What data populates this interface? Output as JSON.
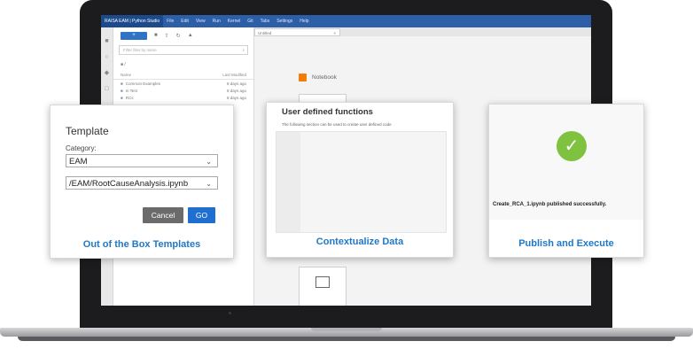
{
  "app": {
    "title": "RAISA EAM | Python Studio",
    "menu": [
      "File",
      "Edit",
      "View",
      "Run",
      "Kernel",
      "Git",
      "Tabs",
      "Settings",
      "Help"
    ]
  },
  "file_browser": {
    "new_button": "+",
    "search_placeholder": "Filter files by name",
    "breadcrumb": "■ /",
    "columns": {
      "name": "Name",
      "modified": "Last Modified"
    },
    "rows": [
      {
        "name": "Common Examples",
        "modified": "8 days ago"
      },
      {
        "name": "In Test",
        "modified": "8 days ago"
      },
      {
        "name": "RCs",
        "modified": "8 days ago"
      }
    ]
  },
  "tabs": [
    {
      "label": "Untitled",
      "close": "×"
    }
  ],
  "launcher": {
    "section": "Notebook"
  },
  "template_card": {
    "title": "Template",
    "category_label": "Category:",
    "category_value": "EAM",
    "file_value": "/EAM/RootCauseAnalysis.ipynb",
    "cancel_label": "Cancel",
    "go_label": "GO",
    "caption": "Out of the Box Templates"
  },
  "udf_card": {
    "title": "User defined functions",
    "description": "The following section can be used to create user defined code",
    "caption": "Contextualize Data"
  },
  "publish_card": {
    "message": "Create_RCA_1.ipynb published successfully.",
    "caption": "Publish and Execute",
    "success_color": "#7ec23f"
  },
  "colors": {
    "caption_blue": "#1f78c8",
    "go_blue": "#1f6fd0",
    "titlebar_blue": "#2c5fa8"
  }
}
